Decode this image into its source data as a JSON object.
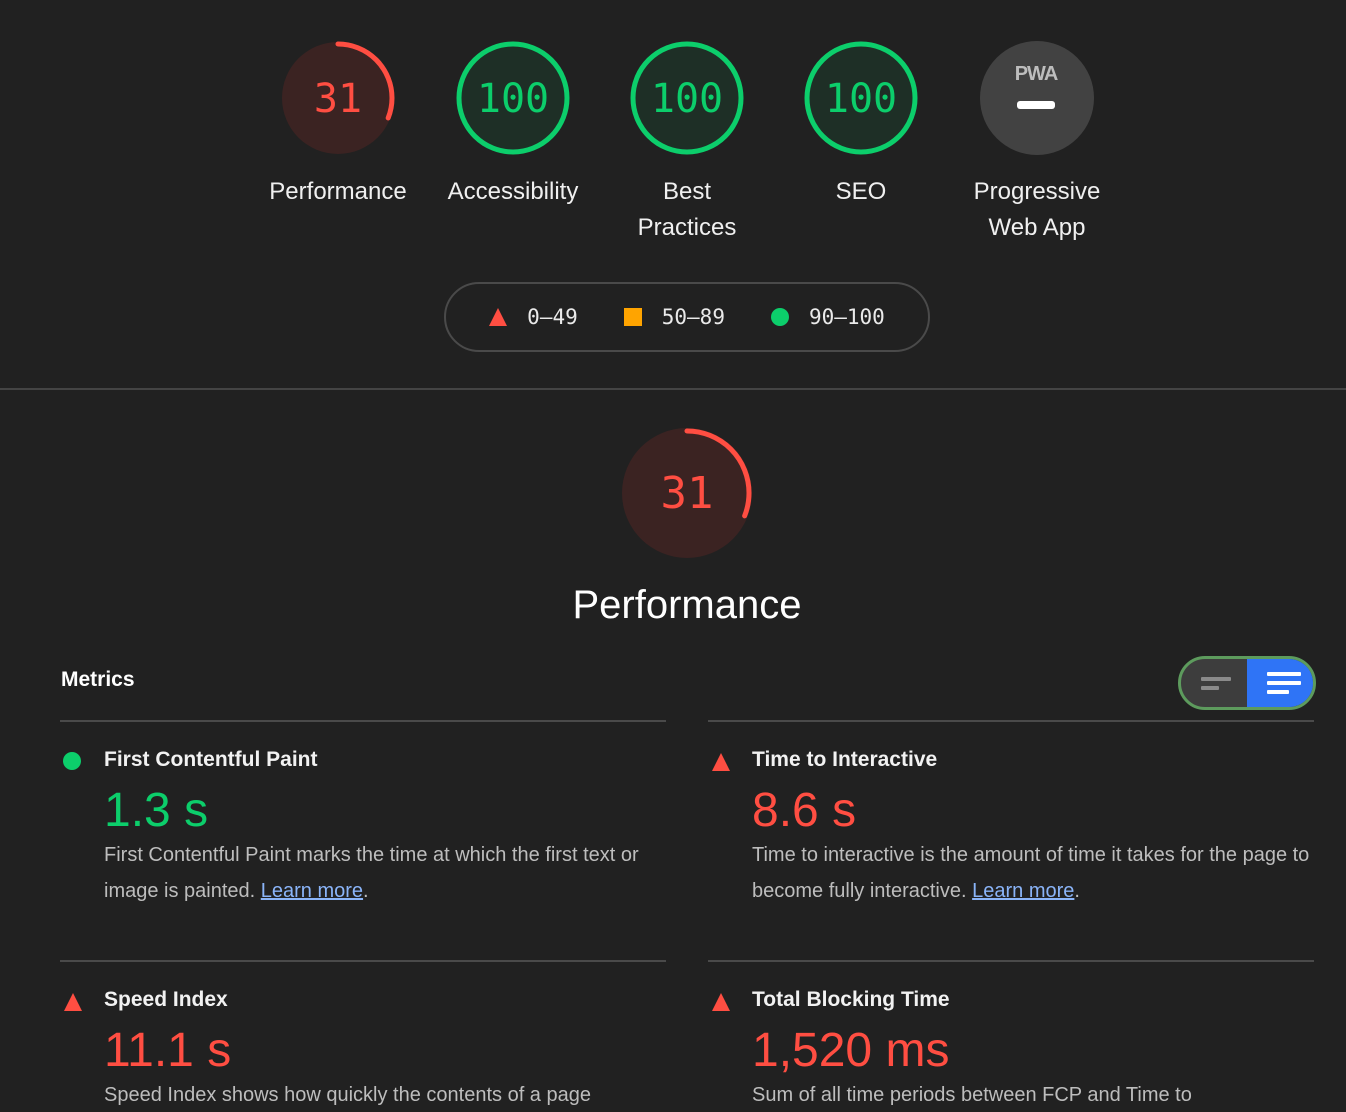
{
  "categories": [
    {
      "label_line1": "Performance",
      "label_line2": "",
      "score": "31",
      "score_value": 31,
      "status": "fail",
      "color": "#ff4e42",
      "bg": "#3b2322"
    },
    {
      "label_line1": "Accessibility",
      "label_line2": "",
      "score": "100",
      "score_value": 100,
      "status": "pass",
      "color": "#0cce6b",
      "bg": "#1e2f26"
    },
    {
      "label_line1": "Best",
      "label_line2": "Practices",
      "score": "100",
      "score_value": 100,
      "status": "pass",
      "color": "#0cce6b",
      "bg": "#1e2f26"
    },
    {
      "label_line1": "SEO",
      "label_line2": "",
      "score": "100",
      "score_value": 100,
      "status": "pass",
      "color": "#0cce6b",
      "bg": "#1e2f26"
    },
    {
      "label_line1": "Progressive",
      "label_line2": "Web App",
      "badge": "PWA",
      "status": "na",
      "color": "#ffffff",
      "bg": "#424242"
    }
  ],
  "legend": [
    {
      "range": "0–49",
      "icon": "triangle-icon",
      "color": "#ff4e42"
    },
    {
      "range": "50–89",
      "icon": "square-icon",
      "color": "#ffa400"
    },
    {
      "range": "90–100",
      "icon": "circle-icon",
      "color": "#0cce6b"
    }
  ],
  "performance": {
    "score": "31",
    "score_value": 31,
    "title": "Performance"
  },
  "metrics_section": {
    "title": "Metrics",
    "toggle": {
      "left_icon": "compact-view-icon",
      "right_icon": "expanded-view-icon",
      "active": "expanded"
    }
  },
  "metrics": [
    {
      "name": "First Contentful Paint",
      "value": "1.3 s",
      "status": "pass",
      "desc": "First Contentful Paint marks the time at which the first text or image is painted.",
      "link": "Learn more",
      "after": "."
    },
    {
      "name": "Time to Interactive",
      "value": "8.6 s",
      "status": "fail",
      "desc": "Time to interactive is the amount of time it takes for the page to become fully interactive.",
      "link": "Learn more",
      "after": "."
    },
    {
      "name": "Speed Index",
      "value": "11.1 s",
      "status": "fail",
      "desc": "Speed Index shows how quickly the contents of a page",
      "link": "",
      "after": ""
    },
    {
      "name": "Total Blocking Time",
      "value": "1,520 ms",
      "status": "fail",
      "desc": "Sum of all time periods between FCP and Time to",
      "link": "",
      "after": ""
    }
  ],
  "colors": {
    "background": "#212121",
    "fail": "#ff4e42",
    "average": "#ffa400",
    "pass": "#0cce6b",
    "link": "#8ab4f8",
    "toggle_active": "#2f74f6"
  }
}
